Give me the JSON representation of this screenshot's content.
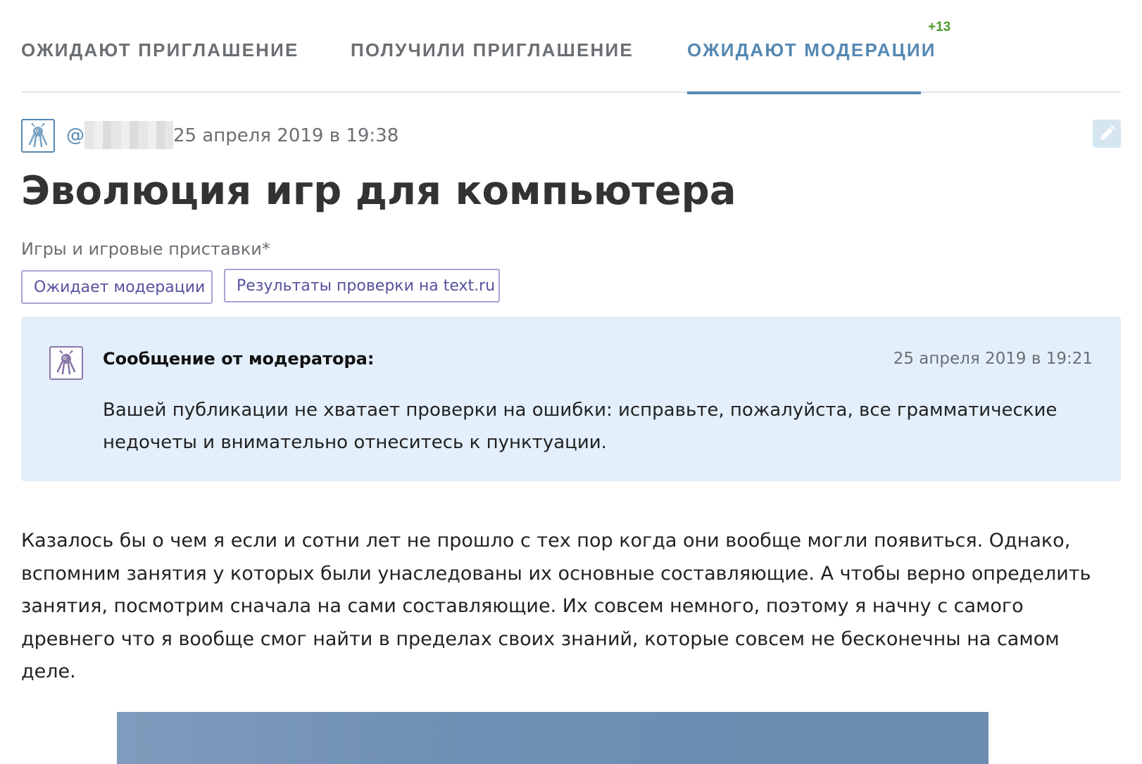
{
  "tabs": [
    {
      "label": "ОЖИДАЮТ ПРИГЛАШЕНИЕ",
      "active": false
    },
    {
      "label": "ПОЛУЧИЛИ ПРИГЛАШЕНИЕ",
      "active": false
    },
    {
      "label": "ОЖИДАЮТ МОДЕРАЦИИ",
      "active": true,
      "badge": "+13"
    }
  ],
  "post": {
    "author_prefix": "@",
    "date": "25 апреля 2019 в 19:38",
    "title": "Эволюция игр для компьютера",
    "hub": "Игры и игровые приставки*",
    "labels": [
      "Ожидает модерации",
      "Результаты проверки на text.ru"
    ],
    "avatar_icon": "octopus-robot-icon",
    "edit_icon": "pencil-icon",
    "body": "Казалось бы о чем я если и сотни лет не прошло с тех пор когда они вообще могли появиться. Однако, вспомним занятия у которых были унаследованы их основные составляющие. А чтобы верно определить занятия, посмотрим сначала на сами составляющие. Их совсем немного, поэтому я начну с самого древнего что я вообще смог найти в пределах своих знаний, которые совсем не бесконечны на самом деле."
  },
  "moderator_message": {
    "title": "Сообщение от модератора:",
    "date": "25 апреля 2019 в 19:21",
    "text": "Вашей публикации не хватает проверки на ошибки: исправьте, пожалуйста, все грамматические недочеты и внимательно отнеситесь к пунктуации.",
    "avatar_icon": "octopus-robot-icon"
  },
  "colors": {
    "accent": "#5488b3",
    "badge": "#4e9a2a",
    "label_border": "#a9a4d2",
    "label_text": "#55529e",
    "mod_background": "#e3effb"
  }
}
